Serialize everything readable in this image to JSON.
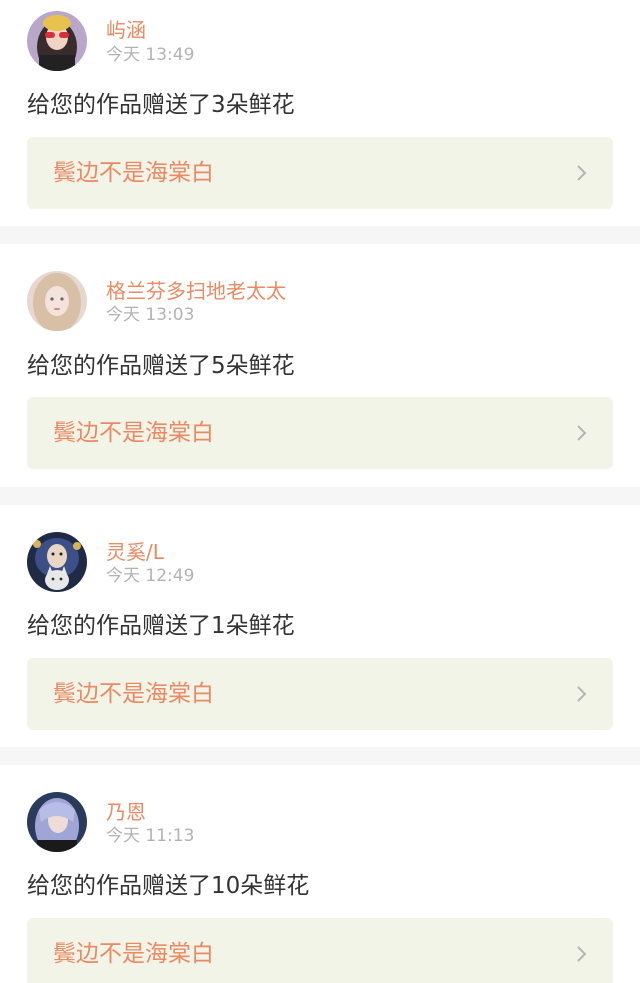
{
  "notifications": [
    {
      "username": "屿涵",
      "timestamp": "今天 13:49",
      "message": "给您的作品赠送了3朵鲜花",
      "work_title": "鬓边不是海棠白",
      "avatar_icon": "avatar-girl-red-glasses"
    },
    {
      "username": "格兰芬多扫地老太太",
      "timestamp": "今天 13:03",
      "message": "给您的作品赠送了5朵鲜花",
      "work_title": "鬓边不是海棠白",
      "avatar_icon": "avatar-blonde-girl"
    },
    {
      "username": "灵奚/L",
      "timestamp": "今天 12:49",
      "message": "给您的作品赠送了1朵鲜花",
      "work_title": "鬓边不是海棠白",
      "avatar_icon": "avatar-illustrated-girl-cat"
    },
    {
      "username": "乃恩",
      "timestamp": "今天 11:13",
      "message": "给您的作品赠送了10朵鲜花",
      "work_title": "鬓边不是海棠白",
      "avatar_icon": "avatar-silver-hair-girl"
    }
  ],
  "colors": {
    "accent": "#ea8a63",
    "tab_indicator": "#e77aa6",
    "link_background": "#f3f4e8",
    "separator": "#f6f6f6",
    "timestamp": "#b3b3b3",
    "message_text": "#333333"
  }
}
